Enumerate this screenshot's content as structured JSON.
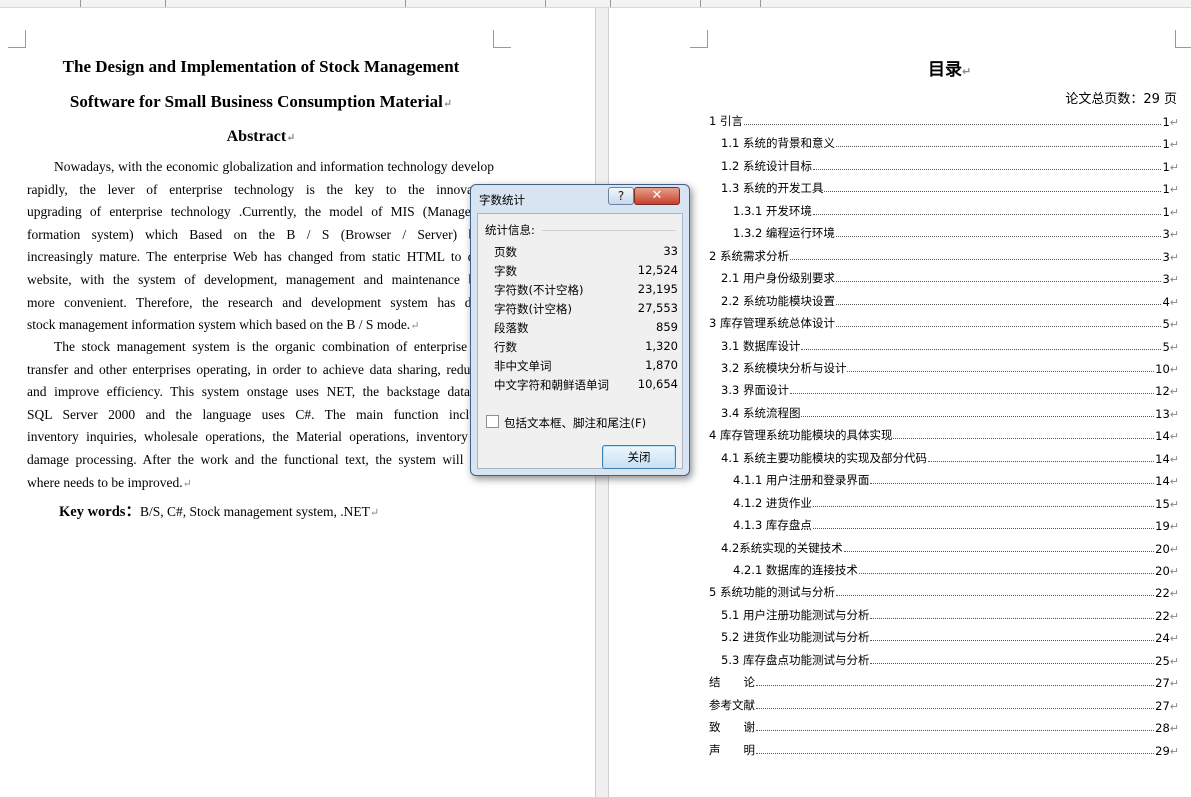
{
  "left_page": {
    "title_line1": "The Design and Implementation of Stock Management",
    "title_line2": "Software for Small Business Consumption Material",
    "abstract_heading": "Abstract",
    "paragraph1_lines": [
      "Nowadays, with the economic globalization and information technology develop",
      "rapidly, the lever of enterprise technology is the key to the innovation",
      "upgrading of enterprise technology .Currently, the model of MIS (Managemen",
      "formation system) which Based on the B / S (Browser / Server)  beco",
      "increasingly mature. The enterprise Web has changed from static HTML to dyna",
      "website, with the system of development, management and maintenance beco",
      "more convenient. Therefore, the research and development system has devel",
      "stock management information system which based on the B / S mode."
    ],
    "paragraph2_lines": [
      "The stock management system is the organic combination of enterprise stor",
      "transfer and other enterprises operating, in order to achieve data sharing, reduce c",
      "and improve efficiency. This system onstage uses NET, the backstage database",
      "SQL Server 2000 and the language uses C#. The main function includes",
      "inventory inquiries, wholesale operations, the Material operations, inventory che",
      "damage processing. After the work and the functional text, the system will poin",
      "where needs to be improved."
    ],
    "keywords_label": "Key words：",
    "keywords_value": "B/S, C#, Stock management system, .NET"
  },
  "right_page": {
    "toc_title": "目录",
    "page_total": "论文总页数：29 页",
    "toc": [
      {
        "text": "1 引言",
        "page": "1",
        "indent": 0
      },
      {
        "text": "1.1 系统的背景和意义",
        "page": "1",
        "indent": 1
      },
      {
        "text": "1.2 系统设计目标",
        "page": "1",
        "indent": 1
      },
      {
        "text": "1.3 系统的开发工具",
        "page": "1",
        "indent": 1
      },
      {
        "text": "1.3.1 开发环境",
        "page": "1",
        "indent": 2
      },
      {
        "text": "1.3.2 编程运行环境",
        "page": "3",
        "indent": 2
      },
      {
        "text": "2 系统需求分析",
        "page": "3",
        "indent": 0
      },
      {
        "text": "2.1 用户身份级别要求",
        "page": "3",
        "indent": 1
      },
      {
        "text": "2.2 系统功能模块设置",
        "page": "4",
        "indent": 1
      },
      {
        "text": "3 库存管理系统总体设计",
        "page": "5",
        "indent": 0
      },
      {
        "text": "3.1 数据库设计",
        "page": "5",
        "indent": 1
      },
      {
        "text": "3.2 系统模块分析与设计",
        "page": "10",
        "indent": 1
      },
      {
        "text": "3.3 界面设计",
        "page": "12",
        "indent": 1
      },
      {
        "text": "3.4 系统流程图",
        "page": "13",
        "indent": 1
      },
      {
        "text": "4 库存管理系统功能模块的具体实现",
        "page": "14",
        "indent": 0
      },
      {
        "text": "4.1 系统主要功能模块的实现及部分代码",
        "page": "14",
        "indent": 1
      },
      {
        "text": "4.1.1 用户注册和登录界面",
        "page": "14",
        "indent": 2
      },
      {
        "text": "4.1.2 进货作业",
        "page": "15",
        "indent": 2
      },
      {
        "text": "4.1.3 库存盘点",
        "page": "19",
        "indent": 2
      },
      {
        "text": "4.2系统实现的关键技术",
        "page": "20",
        "indent": 1
      },
      {
        "text": "4.2.1 数据库的连接技术",
        "page": "20",
        "indent": 2
      },
      {
        "text": "5 系统功能的测试与分析",
        "page": "22",
        "indent": 0
      },
      {
        "text": "5.1 用户注册功能测试与分析",
        "page": "22",
        "indent": 1
      },
      {
        "text": "5.2 进货作业功能测试与分析",
        "page": "24",
        "indent": 1
      },
      {
        "text": "5.3 库存盘点功能测试与分析",
        "page": "25",
        "indent": 1
      },
      {
        "text": "结　　论",
        "page": "27",
        "indent": 0
      },
      {
        "text": "参考文献",
        "page": "27",
        "indent": 0
      },
      {
        "text": "致　　谢",
        "page": "28",
        "indent": 0
      },
      {
        "text": "声　　明",
        "page": "29",
        "indent": 0
      }
    ]
  },
  "dialog": {
    "title": "字数统计",
    "help_glyph": "?",
    "close_glyph": "✕",
    "section_label": "统计信息:",
    "stats": [
      {
        "label": "页数",
        "value": "33"
      },
      {
        "label": "字数",
        "value": "12,524"
      },
      {
        "label": "字符数(不计空格)",
        "value": "23,195"
      },
      {
        "label": "字符数(计空格)",
        "value": "27,553"
      },
      {
        "label": "段落数",
        "value": "859"
      },
      {
        "label": "行数",
        "value": "1,320"
      },
      {
        "label": "非中文单词",
        "value": "1,870"
      },
      {
        "label": "中文字符和朝鲜语单词",
        "value": "10,654"
      }
    ],
    "include_checkbox_label": "包括文本框、脚注和尾注(F)",
    "include_checked": false,
    "close_button_label": "关闭"
  },
  "paragraph_mark": "↵"
}
